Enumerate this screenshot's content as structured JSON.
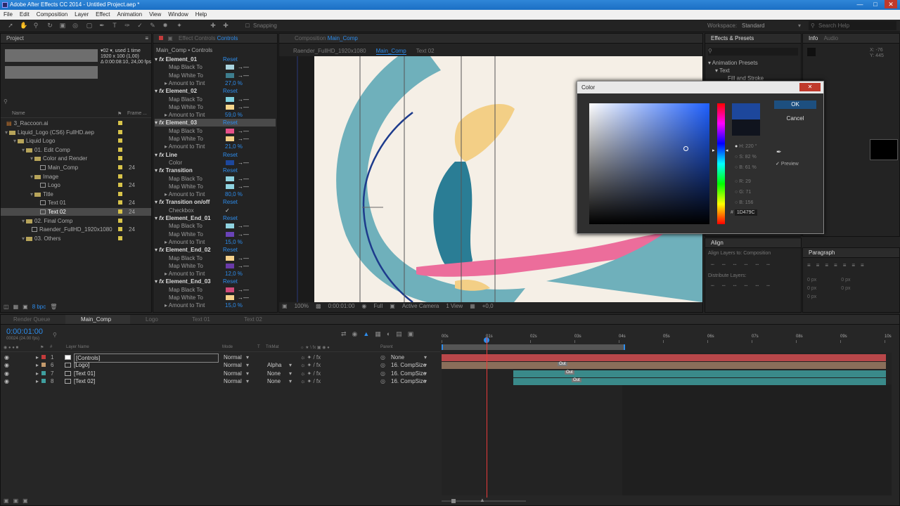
{
  "app": {
    "title": "Adobe After Effects CC 2014 - Untitled Project.aep *"
  },
  "menu": [
    "File",
    "Edit",
    "Composition",
    "Layer",
    "Effect",
    "Animation",
    "View",
    "Window",
    "Help"
  ],
  "toolbar": {
    "snapping": "Snapping",
    "workspace_label": "Workspace:",
    "workspace_value": "Standard",
    "search_placeholder": "Search Help"
  },
  "project": {
    "tab": "Project",
    "info_line1": "▾02 ▾, used 1 time",
    "info_line2": "1920 x 100 (1,00)",
    "info_line3": "Δ 0:00:08:10, 24,00 fps",
    "col_name": "Name",
    "col_frame": "Frame ...",
    "items": [
      {
        "name": "3_Raccoon.ai",
        "indent": 0,
        "icon": "file-ai-icon",
        "label": "#d8c44a",
        "fps": ""
      },
      {
        "name": "Liquid_Logo (CS6) FullHD.aep",
        "indent": 0,
        "icon": "folder-icon",
        "label": "#d8c44a",
        "fps": ""
      },
      {
        "name": "Liquid Logo",
        "indent": 1,
        "icon": "folder-icon",
        "label": "#d8c44a",
        "fps": ""
      },
      {
        "name": "01. Edit Comp",
        "indent": 2,
        "icon": "folder-icon",
        "label": "#d8c44a",
        "fps": ""
      },
      {
        "name": "Color and Render",
        "indent": 3,
        "icon": "folder-icon",
        "label": "#d8c44a",
        "fps": ""
      },
      {
        "name": "Main_Comp",
        "indent": 4,
        "icon": "comp-icon",
        "label": "#d8c44a",
        "fps": "24"
      },
      {
        "name": "Image",
        "indent": 3,
        "icon": "folder-icon",
        "label": "#d8c44a",
        "fps": ""
      },
      {
        "name": "Logo",
        "indent": 4,
        "icon": "comp-icon",
        "label": "#d8c44a",
        "fps": "24"
      },
      {
        "name": "Title",
        "indent": 3,
        "icon": "folder-icon",
        "label": "#d8c44a",
        "fps": ""
      },
      {
        "name": "Text 01",
        "indent": 4,
        "icon": "comp-icon",
        "label": "#d8c44a",
        "fps": "24"
      },
      {
        "name": "Text 02",
        "indent": 4,
        "icon": "comp-icon",
        "label": "#d8c44a",
        "fps": "24",
        "selected": true
      },
      {
        "name": "02. Final Comp",
        "indent": 2,
        "icon": "folder-icon",
        "label": "#d8c44a",
        "fps": ""
      },
      {
        "name": "Raender_FullHD_1920x1080",
        "indent": 3,
        "icon": "comp-icon",
        "label": "#d8c44a",
        "fps": "24"
      },
      {
        "name": "03. Others",
        "indent": 2,
        "icon": "folder-icon",
        "label": "#d8c44a",
        "fps": ""
      }
    ],
    "bpc": "8 bpc"
  },
  "effects_controls": {
    "tab": "Effect Controls",
    "layer": "Controls",
    "breadcrumb": "Main_Comp • Controls",
    "reset": "Reset",
    "rows": [
      {
        "type": "fx",
        "name": "Element_01"
      },
      {
        "type": "prop",
        "name": "Map Black To",
        "color": "#a9d3de"
      },
      {
        "type": "prop",
        "name": "Map White To",
        "color": "#3e7e8e"
      },
      {
        "type": "num",
        "name": "Amount to Tint",
        "value": "27,0 %"
      },
      {
        "type": "fx",
        "name": "Element_02"
      },
      {
        "type": "prop",
        "name": "Map Black To",
        "color": "#7fd0de"
      },
      {
        "type": "prop",
        "name": "Map White To",
        "color": "#f6d58a"
      },
      {
        "type": "num",
        "name": "Amount to Tint",
        "value": "59,0 %"
      },
      {
        "type": "fx",
        "name": "Element_03",
        "selected": true
      },
      {
        "type": "prop",
        "name": "Map Black To",
        "color": "#e6508a"
      },
      {
        "type": "prop",
        "name": "Map White To",
        "color": "#f3cf86"
      },
      {
        "type": "num",
        "name": "Amount to Tint",
        "value": "21,0 %"
      },
      {
        "type": "fx",
        "name": "Line"
      },
      {
        "type": "prop",
        "name": "Color",
        "color": "#1d479c"
      },
      {
        "type": "fx",
        "name": "Transition"
      },
      {
        "type": "prop",
        "name": "Map Black To",
        "color": "#8fd3e0"
      },
      {
        "type": "prop",
        "name": "Map White To",
        "color": "#8fd3e0"
      },
      {
        "type": "num",
        "name": "Amount to Tint",
        "value": "80,0 %"
      },
      {
        "type": "fx",
        "name": "Transition on/off"
      },
      {
        "type": "check",
        "name": "Checkbox",
        "value": "✓"
      },
      {
        "type": "fx",
        "name": "Element_End_01"
      },
      {
        "type": "prop",
        "name": "Map Black To",
        "color": "#8fd3e0"
      },
      {
        "type": "prop",
        "name": "Map White To",
        "color": "#6a43b8"
      },
      {
        "type": "num",
        "name": "Amount to Tint",
        "value": "15,0 %"
      },
      {
        "type": "fx",
        "name": "Element_End_02"
      },
      {
        "type": "prop",
        "name": "Map Black To",
        "color": "#f6d18a"
      },
      {
        "type": "prop",
        "name": "Map White To",
        "color": "#6a3aa8"
      },
      {
        "type": "num",
        "name": "Amount to Tint",
        "value": "12,0 %"
      },
      {
        "type": "fx",
        "name": "Element_End_03"
      },
      {
        "type": "prop",
        "name": "Map Black To",
        "color": "#d04a7a"
      },
      {
        "type": "prop",
        "name": "Map White To",
        "color": "#f6d18a"
      },
      {
        "type": "num",
        "name": "Amount to Tint",
        "value": "15,0 %"
      }
    ]
  },
  "composition": {
    "tab": "Composition",
    "comp_name": "Main_Comp",
    "tabs": [
      "Raender_FullHD_1920x1080",
      "Main_Comp",
      "Text 02"
    ],
    "footer": {
      "zoom": "100%",
      "time": "0:00:01:00",
      "quality": "Full",
      "camera": "Active Camera",
      "view": "1 View",
      "exposure": "+0,0"
    }
  },
  "color_dialog": {
    "title": "Color",
    "ok": "OK",
    "cancel": "Cancel",
    "h": "H: 220 °",
    "s": "S: 82 %",
    "b": "B: 61 %",
    "r": "R: 29",
    "g": "G: 71",
    "bv": "B: 156",
    "hex_label": "#",
    "hex": "1D479C",
    "preview": "Preview",
    "new_color": "#1d479c",
    "old_color": "#10141e"
  },
  "effects_presets": {
    "tab": "Effects & Presets",
    "items": [
      "▾ Animation Presets",
      "▾ Text",
      "Fill and Stroke"
    ]
  },
  "info": {
    "tab": "Info",
    "audio_tab": "Audio",
    "x": "X: -76",
    "y": "Y: 445"
  },
  "align": {
    "tab": "Align",
    "align_to": "Align Layers to:",
    "align_to_value": "Composition",
    "distribute": "Distribute Layers:"
  },
  "paragraph": {
    "tab": "Paragraph",
    "px": [
      "0 px",
      "0 px",
      "0 px",
      "0 px",
      "0 px"
    ]
  },
  "timeline": {
    "tabs": [
      "Render Queue",
      "Main_Comp",
      "Logo",
      "Text 01",
      "Text 02"
    ],
    "timecode": "0:00:01:00",
    "frames": "00024 (24.00 fps)",
    "col_layer_name": "Layer Name",
    "col_mode": "Mode",
    "col_trkmat": "TrkMat",
    "col_parent": "Parent",
    "ruler": [
      "00s",
      "01s",
      "02s",
      "03s",
      "04s",
      "05s",
      "06s",
      "07s",
      "08s",
      "09s",
      "10s"
    ],
    "layers": [
      {
        "num": "1",
        "name": "[Controls]",
        "mode": "Normal",
        "trkmat": "",
        "parent": "None",
        "label": "#c33b3b",
        "selected": true,
        "bar_start": 0.0,
        "bar_end": 1.0,
        "bar_color": "#b8474a"
      },
      {
        "num": "6",
        "name": "[Logo]",
        "mode": "Normal",
        "trkmat": "Alpha",
        "parent": "16. CompSize",
        "label": "#c49a6c",
        "bar_start": 0.0,
        "bar_end": 1.0,
        "bar_color": "#8a6e5a",
        "marker": "Out"
      },
      {
        "num": "7",
        "name": "[Text 01]",
        "mode": "Normal",
        "trkmat": "None",
        "parent": "16. CompSize",
        "label": "#3f9f9f",
        "bar_start": 0.16,
        "bar_end": 1.0,
        "bar_color": "#3a8a8a",
        "marker": "Out"
      },
      {
        "num": "8",
        "name": "[Text 02]",
        "mode": "Normal",
        "trkmat": "None",
        "parent": "16. CompSize",
        "label": "#3f9f9f",
        "bar_start": 0.16,
        "bar_end": 1.0,
        "bar_color": "#3a8a8a",
        "marker": "Out"
      }
    ],
    "playhead_fraction": 0.1,
    "work_area_end_fraction": 0.405
  }
}
